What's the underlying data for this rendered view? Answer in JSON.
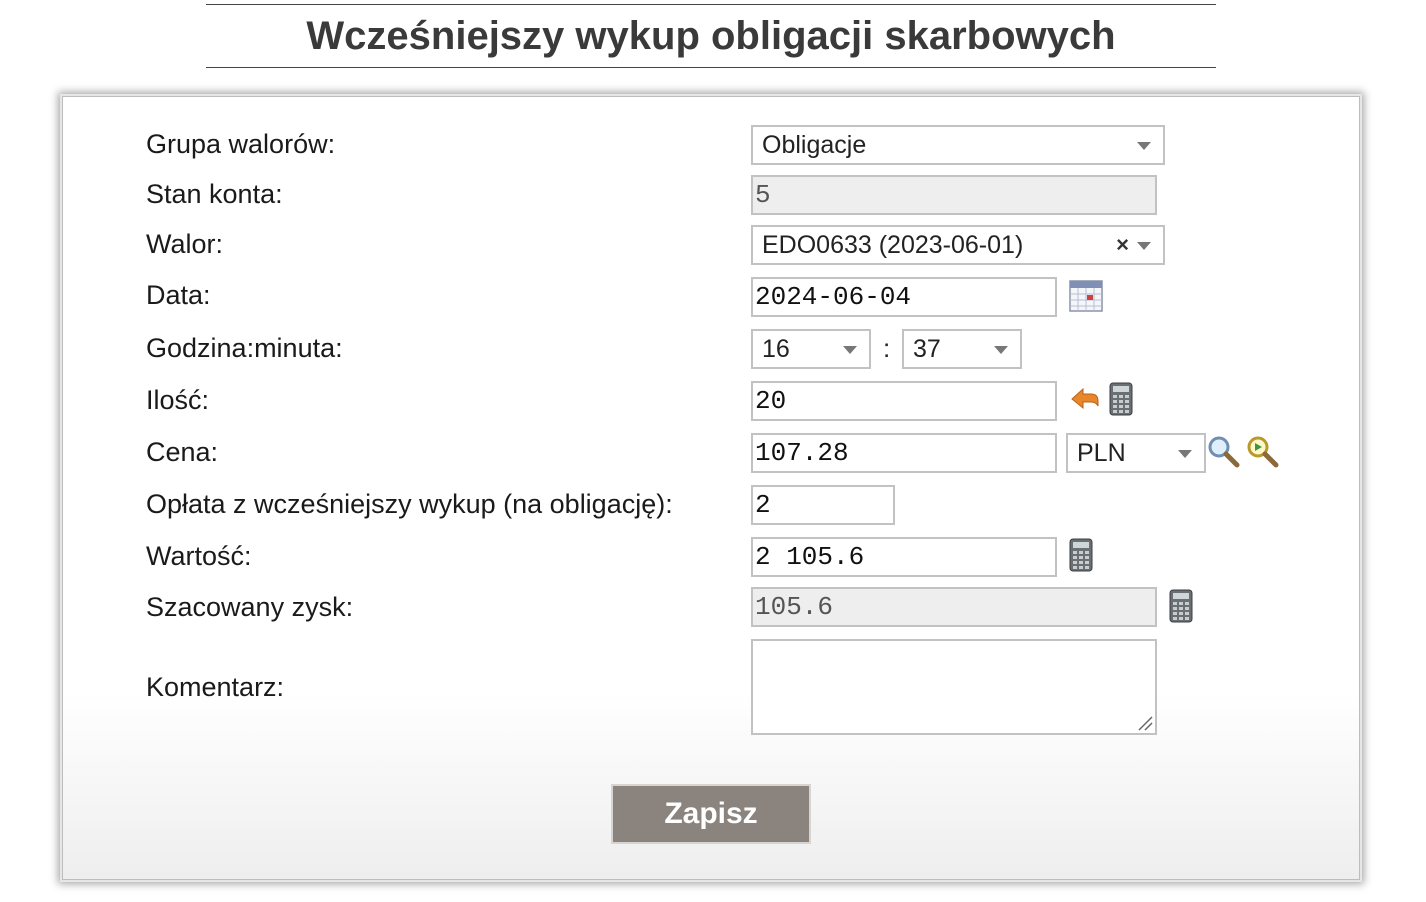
{
  "page": {
    "title": "Wcześniejszy wykup obligacji skarbowych"
  },
  "form": {
    "group_label": "Grupa walorów:",
    "group_value": "Obligacje",
    "balance_label": "Stan konta:",
    "balance_value": "5",
    "security_label": "Walor:",
    "security_value": "EDO0633 (2023-06-01)",
    "security_clear": "×",
    "date_label": "Data:",
    "date_value": "2024-06-04",
    "time_label": "Godzina:minuta:",
    "hour_value": "16",
    "time_separator": ":",
    "minute_value": "37",
    "quantity_label": "Ilość:",
    "quantity_value": "20",
    "price_label": "Cena:",
    "price_value": "107.28",
    "currency_value": "PLN",
    "fee_label": "Opłata z wcześniejszy wykup (na obligację):",
    "fee_value": "2",
    "value_label": "Wartość:",
    "value_value": "2 105.6",
    "profit_label": "Szacowany zysk:",
    "profit_value": "105.6",
    "comment_label": "Komentarz:",
    "comment_value": ""
  },
  "actions": {
    "save_label": "Zapisz"
  },
  "icons": {
    "calendar": "calendar-icon",
    "arrow": "arrow-left-icon",
    "calculator": "calculator-icon",
    "search": "search-icon",
    "search_advanced": "search-advanced-icon"
  },
  "colors": {
    "save_button": "#8b847e",
    "readonly_bg": "#eeeeee",
    "arrow": "#e8872a"
  }
}
